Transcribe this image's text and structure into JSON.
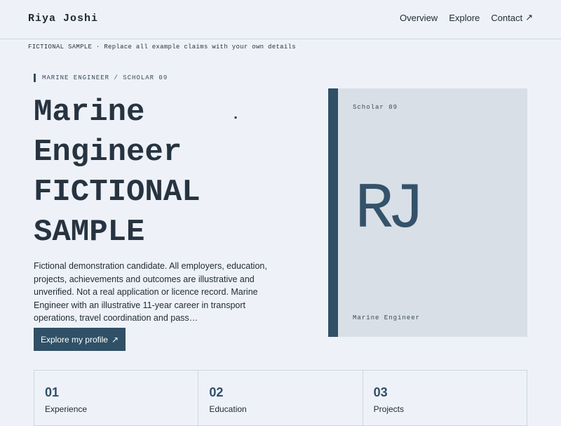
{
  "header": {
    "brand": "Riya Joshi",
    "nav": [
      {
        "label": "Overview"
      },
      {
        "label": "Explore"
      },
      {
        "label": "Contact",
        "icon": "arrow-up-right-icon"
      }
    ]
  },
  "notice": "FICTIONAL SAMPLE · Replace all example claims with your own details",
  "hero": {
    "eyebrow": "MARINE ENGINEER / SCHOLAR 09",
    "headline_lines": [
      "Marine",
      "Engineer",
      "FICTIONAL",
      "SAMPLE"
    ],
    "headline_dot": "·",
    "intro": "Fictional demonstration candidate. All employers, education, projects, achievements and outcomes are illustrative and unverified. Not a real application or licence record. Marine Engineer with an illustrative 11-year career in transport operations, travel coordination and pass…",
    "cta_label": "Explore my profile",
    "cta_icon": "arrow-up-right-icon"
  },
  "card": {
    "top_label": "Scholar 09",
    "monogram": "RJ",
    "bottom_label": "Marine Engineer",
    "accent": "#2f5066"
  },
  "stats": [
    {
      "num": "01",
      "label": "Experience"
    },
    {
      "num": "02",
      "label": "Education"
    },
    {
      "num": "03",
      "label": "Projects"
    }
  ]
}
